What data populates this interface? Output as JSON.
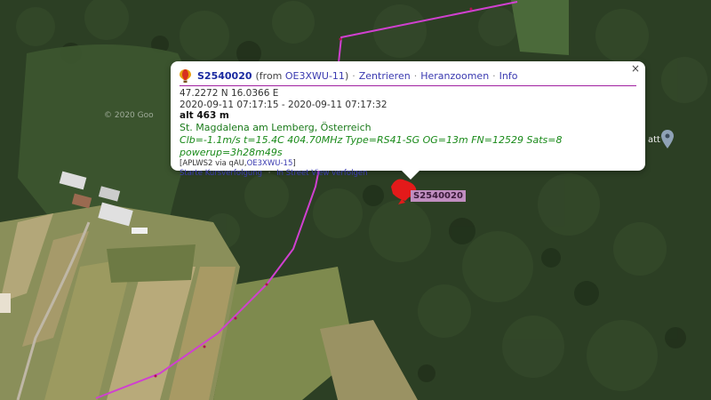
{
  "map": {
    "watermark": "© 2020 Goo",
    "place_label_edge": "att",
    "track_color": "#d040d0",
    "marker_color": "#e31a1a"
  },
  "popup": {
    "callsign": "S2540020",
    "from_prefix": "(from ",
    "from_station": "OE3XWU-11",
    "from_suffix": ")",
    "actions": [
      "Zentrieren",
      "Heranzoomen",
      "Info"
    ],
    "coords": "47.2272 N 16.0366 E",
    "time_range": "2020-09-11 07:17:15 - 2020-09-11 07:17:32",
    "altitude": "alt 463 m",
    "location": "St. Magdalena am Lemberg, Österreich",
    "comment": "Clb=-1.1m/s t=15.4C 404.70MHz Type=RS41-SG OG=13m FN=12529 Sats=8 powerup=3h28m49s",
    "path_prefix": "[APLWS2 via qAU,",
    "path_station": "OE3XWU-15",
    "path_suffix": "]",
    "link_track": "Starte Kursverfolgung",
    "link_streetview": "In Street View verfolgen",
    "close": "×"
  },
  "marker_label": "S2540020"
}
